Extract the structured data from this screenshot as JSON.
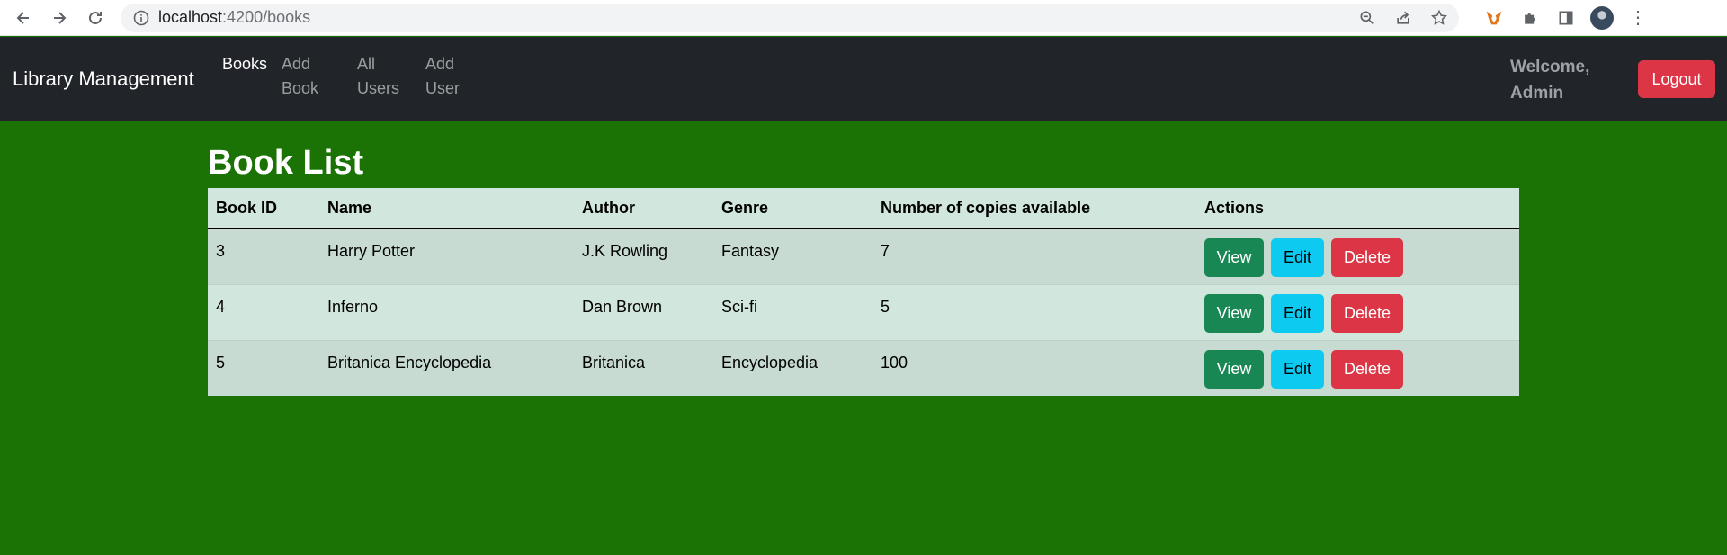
{
  "browser": {
    "url_host": "localhost",
    "url_path": ":4200/books"
  },
  "navbar": {
    "brand": "Library Management",
    "links": [
      {
        "label": "Books",
        "active": true
      },
      {
        "label": "Add Book",
        "active": false
      },
      {
        "label": "All Users",
        "active": false
      },
      {
        "label": "Add User",
        "active": false
      }
    ],
    "welcome": "Welcome, Admin",
    "logout_label": "Logout"
  },
  "page": {
    "title": "Book List"
  },
  "table": {
    "headers": [
      "Book ID",
      "Name",
      "Author",
      "Genre",
      "Number of copies available",
      "Actions"
    ],
    "rows": [
      {
        "id": "3",
        "name": "Harry Potter",
        "author": "J.K Rowling",
        "genre": "Fantasy",
        "copies": "7"
      },
      {
        "id": "4",
        "name": "Inferno",
        "author": "Dan Brown",
        "genre": "Sci-fi",
        "copies": "5"
      },
      {
        "id": "5",
        "name": "Britanica Encyclopedia",
        "author": "Britanica",
        "genre": "Encyclopedia",
        "copies": "100"
      }
    ],
    "actions": {
      "view": "View",
      "edit": "Edit",
      "delete": "Delete"
    }
  },
  "colors": {
    "page_bg": "#1b7305",
    "navbar_bg": "#212529",
    "danger": "#dc3545",
    "success": "#198754",
    "info": "#0dcaf0",
    "table_bg": "#d1e7dd"
  }
}
